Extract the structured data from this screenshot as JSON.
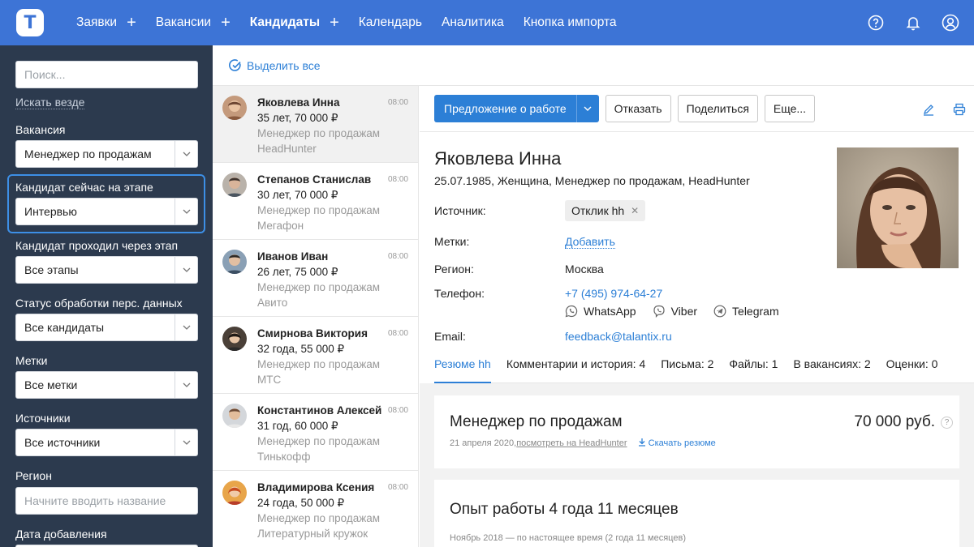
{
  "nav": {
    "logo": "T",
    "items": [
      {
        "label": "Заявки",
        "plus": "+"
      },
      {
        "label": "Вакансии",
        "plus": "+"
      },
      {
        "label": "Кандидаты",
        "plus": "+"
      },
      {
        "label": "Календарь"
      },
      {
        "label": "Аналитика"
      },
      {
        "label": "Кнопка импорта"
      }
    ],
    "active": "Кандидаты",
    "icons": [
      "help-icon",
      "bell-icon",
      "user-icon"
    ]
  },
  "filters": {
    "search_placeholder": "Поиск...",
    "search_everywhere": "Искать везде",
    "vacancy_label": "Вакансия",
    "vacancy_value": "Менеджер по продажам",
    "stage_now_label": "Кандидат сейчас на этапе",
    "stage_now_value": "Интервью",
    "stage_passed_label": "Кандидат проходил через этап",
    "stage_passed_value": "Все этапы",
    "pd_status_label": "Статус обработки перс. данных",
    "pd_status_value": "Все кандидаты",
    "tags_label": "Метки",
    "tags_value": "Все метки",
    "sources_label": "Источники",
    "sources_value": "Все источники",
    "region_label": "Регион",
    "region_placeholder": "Начните вводить название",
    "date_label": "Дата добавления"
  },
  "list": {
    "select_all": "Выделить все",
    "candidates": [
      {
        "name": "Яковлева Инна",
        "time": "08:00",
        "age_salary": "35 лет, 70 000 ₽",
        "position": "Менеджер по продажам",
        "source": "HeadHunter",
        "avatar_color": "#a0705a"
      },
      {
        "name": "Степанов Станислав",
        "time": "08:00",
        "age_salary": "30 лет, 70 000 ₽",
        "position": "Менеджер по продажам",
        "source": "Мегафон",
        "avatar_color": "#7a6a62"
      },
      {
        "name": "Иванов Иван",
        "time": "08:00",
        "age_salary": "26 лет, 75 000 ₽",
        "position": "Менеджер по продажам",
        "source": "Авито",
        "avatar_color": "#5b6f86"
      },
      {
        "name": "Смирнова Виктория",
        "time": "08:00",
        "age_salary": "32 года, 55 000 ₽",
        "position": "Менеджер по продажам",
        "source": "МТС",
        "avatar_color": "#3f3a33"
      },
      {
        "name": "Константинов Алексей",
        "time": "08:00",
        "age_salary": "31 год, 60 000 ₽",
        "position": "Менеджер по продажам",
        "source": "Тинькофф",
        "avatar_color": "#8a8f96"
      },
      {
        "name": "Владимирова Ксения",
        "time": "08:00",
        "age_salary": "24 года, 50 000 ₽",
        "position": "Менеджер по продажам",
        "source": "Литературный кружок",
        "avatar_color": "#d8642e"
      }
    ]
  },
  "profile": {
    "toolbar": {
      "offer": "Предложение о работе",
      "reject": "Отказать",
      "share": "Поделиться",
      "more": "Еще..."
    },
    "name": "Яковлева Инна",
    "meta": "25.07.1985, Женщина, Менеджер по продажам, HeadHunter",
    "source_label": "Источник:",
    "source_tag": "Отклик hh",
    "tags_label": "Метки:",
    "tags_add": "Добавить",
    "region_label": "Регион:",
    "region_value": "Москва",
    "phone_label": "Телефон:",
    "phone_value": "+7 (495) 974-64-27",
    "messengers": [
      "WhatsApp",
      "Viber",
      "Telegram"
    ],
    "email_label": "Email:",
    "email_value": "feedback@talantix.ru",
    "tabs": [
      "Резюме hh",
      "Комментарии и история: 4",
      "Письма: 2",
      "Файлы: 1",
      "В вакансиях: 2",
      "Оценки: 0"
    ],
    "resume": {
      "title": "Менеджер по продажам",
      "salary": "70 000 руб.",
      "date": "21 апреля 2020,",
      "view_link": "посмотреть на HeadHunter",
      "download": "Скачать резюме",
      "help": "?"
    },
    "experience": {
      "title": "Опыт работы 4 года 11 месяцев",
      "period": "Ноябрь 2018 — по настоящее время (2 года 11 месяцев)"
    }
  },
  "colors": {
    "brand": "#3d74d6",
    "sidebar": "#2c3a4e",
    "link": "#2c7fd6"
  }
}
